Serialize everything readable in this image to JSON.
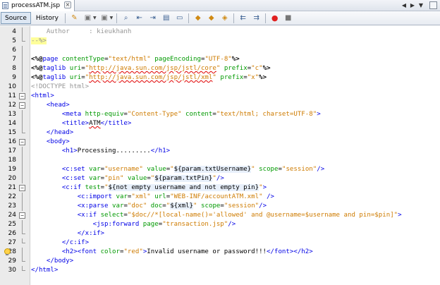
{
  "tab": {
    "title": "processATM.jsp",
    "close_symbol": "×"
  },
  "toolbar": {
    "source_label": "Source",
    "history_label": "History"
  },
  "lines": [
    {
      "num": "4",
      "fold": "none",
      "segs": [
        {
          "c": "t-comment",
          "t": "    Author     : kieukhanh"
        }
      ]
    },
    {
      "num": "5",
      "fold": "end",
      "segs": [
        {
          "c": "t-comment hl",
          "t": "--%>"
        }
      ]
    },
    {
      "num": "6",
      "fold": "none",
      "segs": []
    },
    {
      "num": "7",
      "fold": "none",
      "segs": [
        {
          "c": "t-jsp",
          "t": "<%@"
        },
        {
          "c": "t-tag",
          "t": "page"
        },
        {
          "c": "t-text",
          "t": " "
        },
        {
          "c": "t-attr",
          "t": "contentType"
        },
        {
          "c": "t-text",
          "t": "="
        },
        {
          "c": "t-val",
          "t": "\"text/html\""
        },
        {
          "c": "t-text",
          "t": " "
        },
        {
          "c": "t-attr",
          "t": "pageEncoding"
        },
        {
          "c": "t-text",
          "t": "="
        },
        {
          "c": "t-val",
          "t": "\"UTF-8\""
        },
        {
          "c": "t-jsp",
          "t": "%>"
        }
      ]
    },
    {
      "num": "8",
      "fold": "none",
      "segs": [
        {
          "c": "t-jsp",
          "t": "<%@"
        },
        {
          "c": "t-tag",
          "t": "taglib"
        },
        {
          "c": "t-text",
          "t": " "
        },
        {
          "c": "t-attr",
          "t": "uri"
        },
        {
          "c": "t-text",
          "t": "="
        },
        {
          "c": "t-val",
          "t": "\""
        },
        {
          "c": "t-val squig",
          "t": "http://java.sun.com/jsp/jstl/core"
        },
        {
          "c": "t-val",
          "t": "\""
        },
        {
          "c": "t-text",
          "t": " "
        },
        {
          "c": "t-attr",
          "t": "prefix"
        },
        {
          "c": "t-text",
          "t": "="
        },
        {
          "c": "t-val",
          "t": "\"c\""
        },
        {
          "c": "t-jsp",
          "t": "%>"
        }
      ]
    },
    {
      "num": "9",
      "fold": "none",
      "segs": [
        {
          "c": "t-jsp",
          "t": "<%@"
        },
        {
          "c": "t-tag",
          "t": "taglib"
        },
        {
          "c": "t-text",
          "t": " "
        },
        {
          "c": "t-attr",
          "t": "uri"
        },
        {
          "c": "t-text",
          "t": "="
        },
        {
          "c": "t-val",
          "t": "\""
        },
        {
          "c": "t-val squig",
          "t": "http://java.sun.com/jsp/jstl/xml"
        },
        {
          "c": "t-val",
          "t": "\""
        },
        {
          "c": "t-text",
          "t": " "
        },
        {
          "c": "t-attr",
          "t": "prefix"
        },
        {
          "c": "t-text",
          "t": "="
        },
        {
          "c": "t-val",
          "t": "\"x\""
        },
        {
          "c": "t-jsp",
          "t": "%>"
        }
      ]
    },
    {
      "num": "10",
      "fold": "none",
      "segs": [
        {
          "c": "t-doctype",
          "t": "<!DOCTYPE html>"
        }
      ]
    },
    {
      "num": "11",
      "fold": "open",
      "segs": [
        {
          "c": "t-tag",
          "t": "<html>"
        }
      ]
    },
    {
      "num": "12",
      "fold": "open",
      "segs": [
        {
          "c": "t-text",
          "t": "    "
        },
        {
          "c": "t-tag",
          "t": "<head>"
        }
      ]
    },
    {
      "num": "13",
      "fold": "none",
      "segs": [
        {
          "c": "t-text",
          "t": "        "
        },
        {
          "c": "t-tag",
          "t": "<meta"
        },
        {
          "c": "t-text",
          "t": " "
        },
        {
          "c": "t-attr",
          "t": "http-equiv"
        },
        {
          "c": "t-text",
          "t": "="
        },
        {
          "c": "t-val",
          "t": "\"Content-Type\""
        },
        {
          "c": "t-text",
          "t": " "
        },
        {
          "c": "t-attr",
          "t": "content"
        },
        {
          "c": "t-text",
          "t": "="
        },
        {
          "c": "t-val",
          "t": "\"text/html; charset=UTF-8\""
        },
        {
          "c": "t-tag",
          "t": ">"
        }
      ]
    },
    {
      "num": "14",
      "fold": "none",
      "segs": [
        {
          "c": "t-text",
          "t": "        "
        },
        {
          "c": "t-tag",
          "t": "<title>"
        },
        {
          "c": "t-text squig",
          "t": "ATM"
        },
        {
          "c": "t-tag",
          "t": "</title>"
        }
      ]
    },
    {
      "num": "15",
      "fold": "end",
      "segs": [
        {
          "c": "t-text",
          "t": "    "
        },
        {
          "c": "t-tag",
          "t": "</head>"
        }
      ]
    },
    {
      "num": "16",
      "fold": "open",
      "segs": [
        {
          "c": "t-text",
          "t": "    "
        },
        {
          "c": "t-tag",
          "t": "<body>"
        }
      ]
    },
    {
      "num": "17",
      "fold": "none",
      "segs": [
        {
          "c": "t-text",
          "t": "        "
        },
        {
          "c": "t-tag",
          "t": "<h1>"
        },
        {
          "c": "t-text",
          "t": "Processing........."
        },
        {
          "c": "t-tag",
          "t": "</h1>"
        }
      ]
    },
    {
      "num": "18",
      "fold": "none",
      "segs": []
    },
    {
      "num": "19",
      "fold": "none",
      "segs": [
        {
          "c": "t-text",
          "t": "        "
        },
        {
          "c": "t-tag",
          "t": "<c:set"
        },
        {
          "c": "t-text",
          "t": " "
        },
        {
          "c": "t-attr",
          "t": "var"
        },
        {
          "c": "t-text",
          "t": "="
        },
        {
          "c": "t-val",
          "t": "\"username\""
        },
        {
          "c": "t-text",
          "t": " "
        },
        {
          "c": "t-attr",
          "t": "value"
        },
        {
          "c": "t-text",
          "t": "="
        },
        {
          "c": "t-val",
          "t": "\""
        },
        {
          "c": "t-el elbg",
          "t": "${param.txtUsername}"
        },
        {
          "c": "t-val",
          "t": "\""
        },
        {
          "c": "t-text",
          "t": " "
        },
        {
          "c": "t-attr",
          "t": "scope"
        },
        {
          "c": "t-text",
          "t": "="
        },
        {
          "c": "t-val",
          "t": "\"session\""
        },
        {
          "c": "t-tag",
          "t": "/>"
        }
      ]
    },
    {
      "num": "20",
      "fold": "none",
      "segs": [
        {
          "c": "t-text",
          "t": "        "
        },
        {
          "c": "t-tag",
          "t": "<c:set"
        },
        {
          "c": "t-text",
          "t": " "
        },
        {
          "c": "t-attr",
          "t": "var"
        },
        {
          "c": "t-text",
          "t": "="
        },
        {
          "c": "t-val",
          "t": "\"pin\""
        },
        {
          "c": "t-text",
          "t": " "
        },
        {
          "c": "t-attr",
          "t": "value"
        },
        {
          "c": "t-text",
          "t": "="
        },
        {
          "c": "t-val",
          "t": "\""
        },
        {
          "c": "t-el elbg",
          "t": "${param.txtPin}"
        },
        {
          "c": "t-val",
          "t": "\""
        },
        {
          "c": "t-tag",
          "t": "/>"
        }
      ]
    },
    {
      "num": "21",
      "fold": "open",
      "segs": [
        {
          "c": "t-text",
          "t": "        "
        },
        {
          "c": "t-tag",
          "t": "<c:if"
        },
        {
          "c": "t-text",
          "t": " "
        },
        {
          "c": "t-attr",
          "t": "test"
        },
        {
          "c": "t-text",
          "t": "="
        },
        {
          "c": "t-val",
          "t": "\""
        },
        {
          "c": "t-el elbg",
          "t": "${not empty username and not empty pin}"
        },
        {
          "c": "t-val",
          "t": "\""
        },
        {
          "c": "t-tag",
          "t": ">"
        }
      ]
    },
    {
      "num": "22",
      "fold": "none",
      "segs": [
        {
          "c": "t-text",
          "t": "            "
        },
        {
          "c": "t-tag",
          "t": "<c:import"
        },
        {
          "c": "t-text",
          "t": " "
        },
        {
          "c": "t-attr",
          "t": "var"
        },
        {
          "c": "t-text",
          "t": "="
        },
        {
          "c": "t-val",
          "t": "\"xml\""
        },
        {
          "c": "t-text",
          "t": " "
        },
        {
          "c": "t-attr",
          "t": "url"
        },
        {
          "c": "t-text",
          "t": "="
        },
        {
          "c": "t-val",
          "t": "\"WEB-INF/accountATM.xml\""
        },
        {
          "c": "t-text",
          "t": " "
        },
        {
          "c": "t-tag",
          "t": "/>"
        }
      ]
    },
    {
      "num": "23",
      "fold": "none",
      "segs": [
        {
          "c": "t-text",
          "t": "            "
        },
        {
          "c": "t-tag",
          "t": "<x:parse"
        },
        {
          "c": "t-text",
          "t": " "
        },
        {
          "c": "t-attr",
          "t": "var"
        },
        {
          "c": "t-text",
          "t": "="
        },
        {
          "c": "t-val",
          "t": "\"doc\""
        },
        {
          "c": "t-text",
          "t": " "
        },
        {
          "c": "t-attr",
          "t": "doc"
        },
        {
          "c": "t-text",
          "t": "="
        },
        {
          "c": "t-val",
          "t": "\""
        },
        {
          "c": "t-el elbg",
          "t": "${xml}"
        },
        {
          "c": "t-val",
          "t": "\""
        },
        {
          "c": "t-text",
          "t": " "
        },
        {
          "c": "t-attr",
          "t": "scope"
        },
        {
          "c": "t-text",
          "t": "="
        },
        {
          "c": "t-val",
          "t": "\"session\""
        },
        {
          "c": "t-tag",
          "t": "/>"
        }
      ]
    },
    {
      "num": "24",
      "fold": "open",
      "segs": [
        {
          "c": "t-text",
          "t": "            "
        },
        {
          "c": "t-tag",
          "t": "<x:if"
        },
        {
          "c": "t-text",
          "t": " "
        },
        {
          "c": "t-attr",
          "t": "select"
        },
        {
          "c": "t-text",
          "t": "="
        },
        {
          "c": "t-val",
          "t": "\"$doc//*[local-name()='allowed' and @username=$username and pin=$pin]\""
        },
        {
          "c": "t-tag",
          "t": ">"
        }
      ]
    },
    {
      "num": "25",
      "fold": "none",
      "segs": [
        {
          "c": "t-text",
          "t": "                "
        },
        {
          "c": "t-tag",
          "t": "<jsp:forward"
        },
        {
          "c": "t-text",
          "t": " "
        },
        {
          "c": "t-attr",
          "t": "page"
        },
        {
          "c": "t-text",
          "t": "="
        },
        {
          "c": "t-val",
          "t": "\"transaction.jsp\""
        },
        {
          "c": "t-tag",
          "t": "/>"
        }
      ]
    },
    {
      "num": "26",
      "fold": "end",
      "segs": [
        {
          "c": "t-text",
          "t": "            "
        },
        {
          "c": "t-tag",
          "t": "</x:if>"
        }
      ]
    },
    {
      "num": "27",
      "fold": "end",
      "segs": [
        {
          "c": "t-text",
          "t": "        "
        },
        {
          "c": "t-tag",
          "t": "</c:if>"
        }
      ]
    },
    {
      "num": "28",
      "fold": "none",
      "bulb": true,
      "segs": [
        {
          "c": "t-text",
          "t": "        "
        },
        {
          "c": "t-tag",
          "t": "<h2>"
        },
        {
          "c": "t-tag",
          "t": "<font"
        },
        {
          "c": "t-text",
          "t": " "
        },
        {
          "c": "t-attr",
          "t": "color"
        },
        {
          "c": "t-text",
          "t": "="
        },
        {
          "c": "t-val",
          "t": "\"red\""
        },
        {
          "c": "t-tag",
          "t": ">"
        },
        {
          "c": "t-text",
          "t": "Invalid username or password!!!"
        },
        {
          "c": "t-tag",
          "t": "</font>"
        },
        {
          "c": "t-tag",
          "t": "</h2>"
        }
      ]
    },
    {
      "num": "29",
      "fold": "end",
      "segs": [
        {
          "c": "t-text",
          "t": "    "
        },
        {
          "c": "t-tag",
          "t": "</body>"
        }
      ]
    },
    {
      "num": "30",
      "fold": "end",
      "segs": [
        {
          "c": "t-tag",
          "t": "</html>"
        }
      ]
    }
  ]
}
